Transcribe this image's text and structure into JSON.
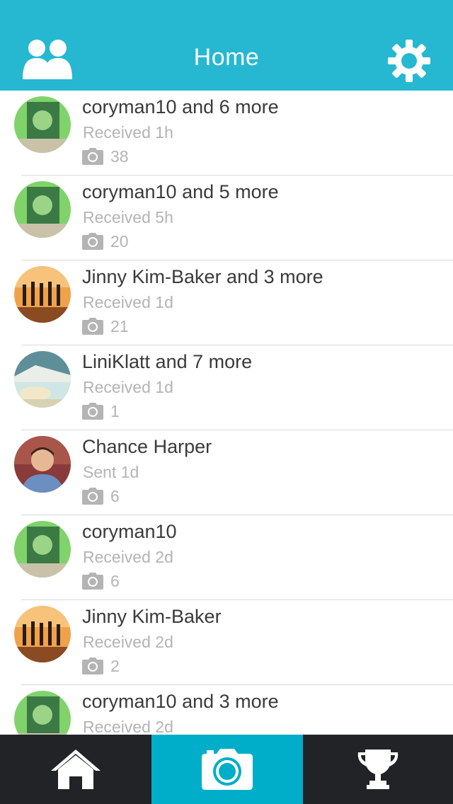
{
  "header": {
    "title": "Home",
    "background": "#26b8d1",
    "left_icon": "friends-icon",
    "right_icon": "gear-icon"
  },
  "threads": [
    {
      "name": "coryman10 and 6 more",
      "status": "Received 1h",
      "photo_count": "38",
      "avatar": "green"
    },
    {
      "name": "coryman10 and 5 more",
      "status": "Received 5h",
      "photo_count": "20",
      "avatar": "green"
    },
    {
      "name": "Jinny Kim-Baker and 3 more",
      "status": "Received 1d",
      "photo_count": "21",
      "avatar": "orange"
    },
    {
      "name": "LiniKlatt and 7 more",
      "status": "Received 1d",
      "photo_count": "1",
      "avatar": "blue"
    },
    {
      "name": "Chance Harper",
      "status": "Sent 1d",
      "photo_count": "6",
      "avatar": "person"
    },
    {
      "name": "coryman10",
      "status": "Received 2d",
      "photo_count": "6",
      "avatar": "green"
    },
    {
      "name": "Jinny Kim-Baker",
      "status": "Received 2d",
      "photo_count": "2",
      "avatar": "orange"
    },
    {
      "name": "coryman10 and 3 more",
      "status": "Received 2d",
      "photo_count": "",
      "avatar": "green"
    }
  ],
  "tabbar": {
    "tabs": [
      {
        "icon": "home-icon",
        "active": false
      },
      {
        "icon": "camera-icon",
        "active": true
      },
      {
        "icon": "trophy-icon",
        "active": false
      }
    ],
    "active_color": "#00aec9",
    "background": "#222326"
  }
}
